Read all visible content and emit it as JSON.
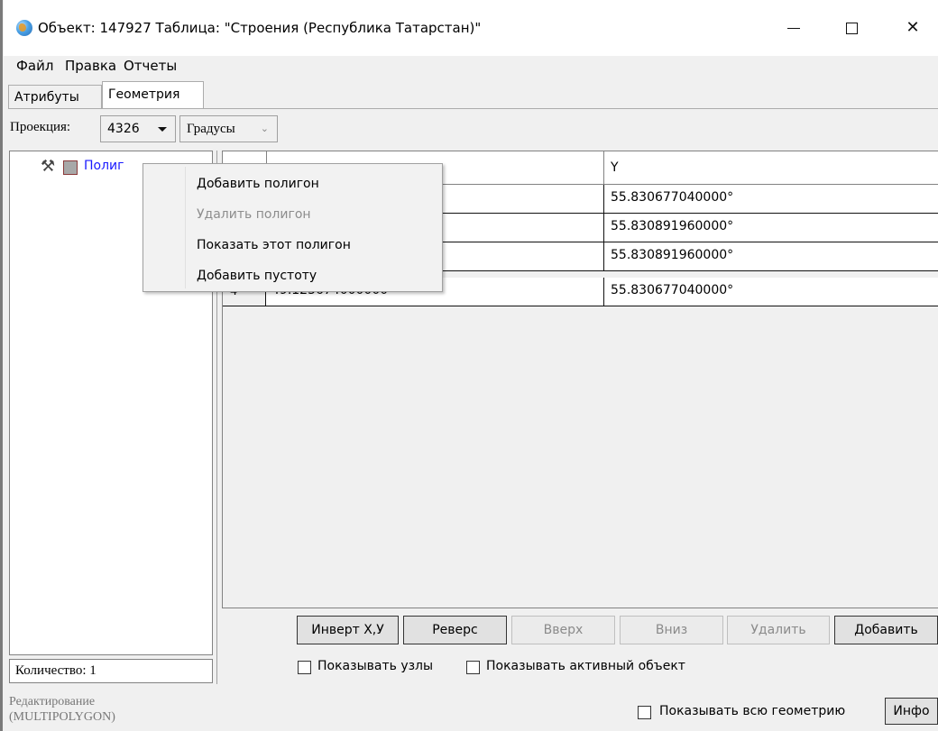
{
  "window": {
    "title": "Объект: 147927 Таблица: \"Строения (Республика Татарстан)\"",
    "app_icon": "globe-icon",
    "controls": {
      "minimize": "minimize-icon",
      "maximize": "maximize-icon",
      "close": "✕"
    }
  },
  "menubar": {
    "items": [
      "Файл",
      "Правка",
      "Отчеты"
    ]
  },
  "tabs": [
    {
      "label": "Атрибуты",
      "active": false
    },
    {
      "label": "Геометрия",
      "active": true
    }
  ],
  "toolbar": {
    "projection_label": "Проекция:",
    "projection_value": "4326",
    "units_value": "Градусы"
  },
  "tree": {
    "item_label": "Полиг",
    "item_icons": [
      "tools-icon",
      "polygon-square-icon"
    ],
    "count_label": "Количество: 1"
  },
  "grid": {
    "header_y": "Y",
    "rows": [
      {
        "num": "",
        "x": "",
        "y": "55.830677040000°"
      },
      {
        "num": "",
        "x": "",
        "y": "55.830891960000°"
      },
      {
        "num": "",
        "x": "",
        "y": "55.830891960000°"
      },
      {
        "num": "4",
        "x": "49.125674000000",
        "y": "55.830677040000°"
      }
    ]
  },
  "buttons": {
    "invert": "Инверт X,У",
    "reverse": "Реверс",
    "up": "Вверх",
    "down": "Вниз",
    "delete": "Удалить",
    "add": "Добавить"
  },
  "checkboxes": {
    "show_nodes": "Показывать узлы",
    "show_active": "Показывать активный объект",
    "show_all_geometry": "Показывать всю геометрию"
  },
  "status": {
    "line1": "Редактирование",
    "line2": "(MULTIPOLYGON)",
    "info_button": "Инфо"
  },
  "context_menu": {
    "items": [
      {
        "label": "Добавить полигон",
        "enabled": true
      },
      {
        "label": "Удалить полигон",
        "enabled": false
      },
      {
        "label": "Показать этот полигон",
        "enabled": true
      },
      {
        "label": "Добавить пустоту",
        "enabled": true
      }
    ]
  }
}
